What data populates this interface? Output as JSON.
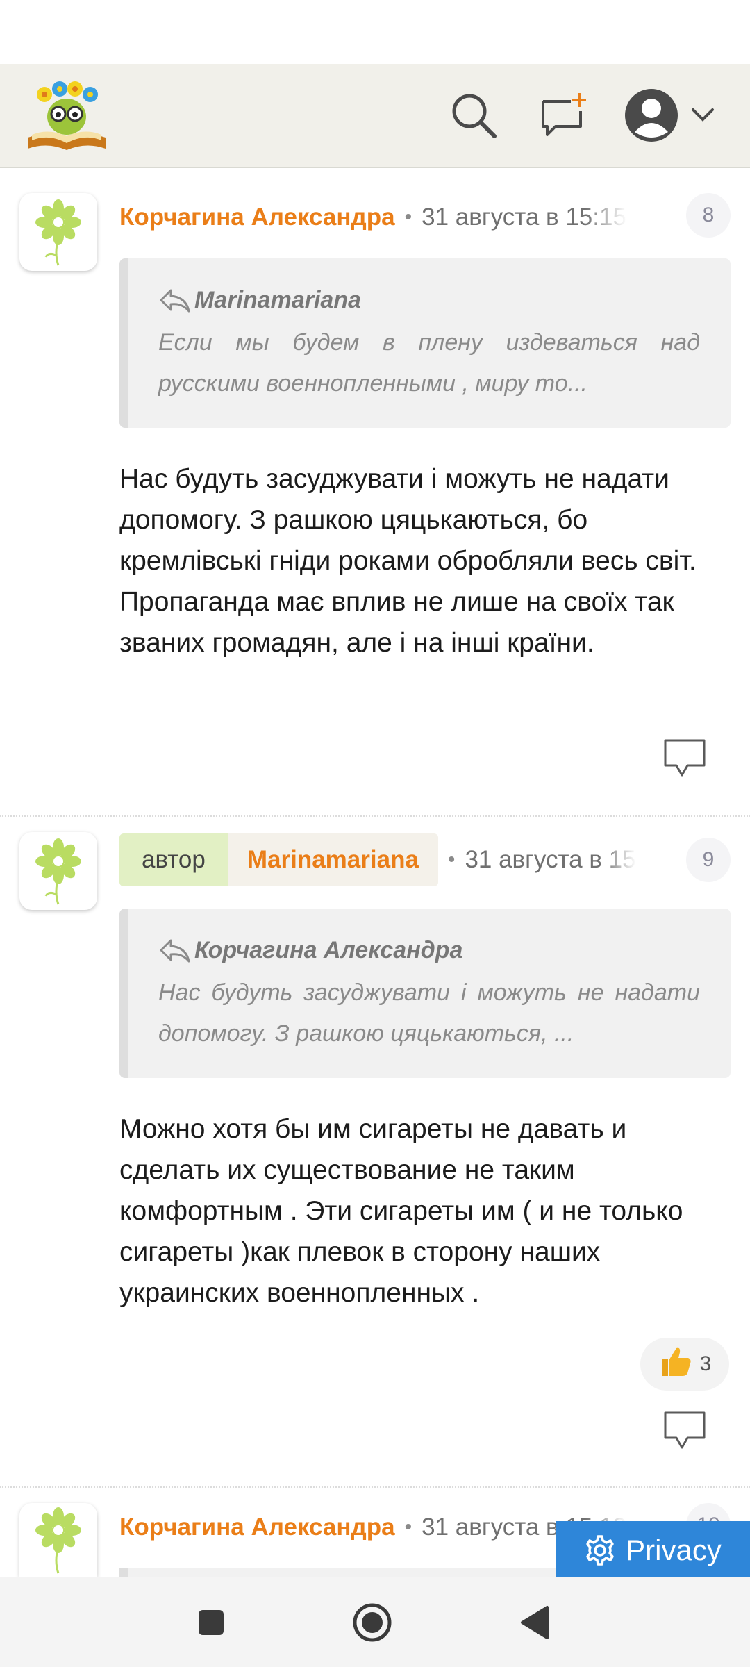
{
  "app": {
    "logo_icon": "bookworm-logo",
    "search_icon": "search-icon",
    "compose_icon": "new-message-icon",
    "profile_icon": "user-avatar-icon"
  },
  "comments": [
    {
      "author": "Корчагина Александра",
      "time": "31 августа в 15:15",
      "number": "8",
      "quote": {
        "author": "Marinamariana",
        "text": "Если мы будем в плену издеваться над русскими военнопленными , миру то..."
      },
      "body": "Нас будуть засуджувати і можуть не надати допомогу. З рашкою цяцькаються, бо кремлівські гніди роками обробляли весь світ. Пропаганда має вплив не лише на своїх так званих громадян, але і на інші країни."
    },
    {
      "author_role": "автор",
      "author": "Marinamariana",
      "time": "31 августа в 15",
      "number": "9",
      "quote": {
        "author": "Корчагина Александра",
        "text": "Нас будуть засуджувати і можуть не надати допомогу. З рашкою цяцькаються, ..."
      },
      "body": "Можно хотя бы им сигареты не давать и сделать их существование не таким комфортным . Эти сигареты им ( и не только сигареты )как плевок в сторону наших украинских военнопленных .",
      "likes": "3"
    },
    {
      "author": "Корчагина Александра",
      "time": "31 августа в 15:18",
      "number": "10"
    }
  ],
  "privacy_label": "Privacy",
  "colors": {
    "accent": "#ea7e18",
    "header_bg": "#f1f0ea",
    "privacy_bg": "#2e86d9",
    "author_chip": "#e2f0c4"
  }
}
